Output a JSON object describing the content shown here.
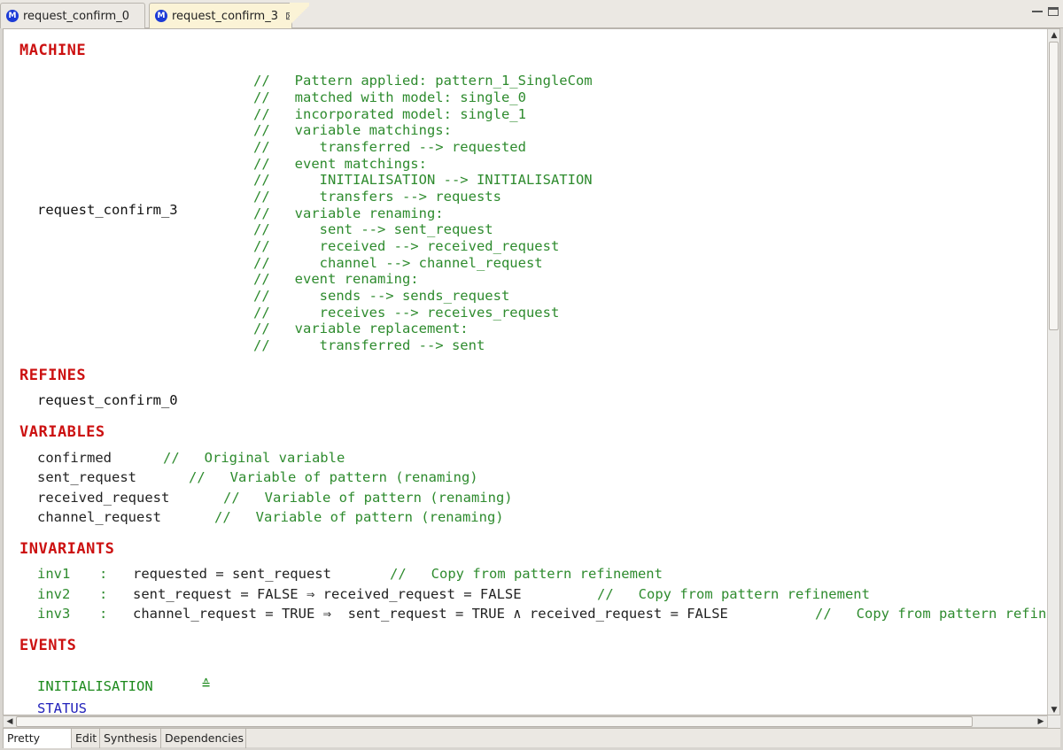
{
  "tabs": [
    {
      "label": "request_confirm_0",
      "active": false
    },
    {
      "label": "request_confirm_3",
      "active": true
    }
  ],
  "tab_icon_letter": "M",
  "machine": {
    "keyword": "MACHINE",
    "name": "request_confirm_3",
    "comments": [
      "//   Pattern applied: pattern_1_SingleCom",
      "//   matched with model: single_0",
      "//   incorporated model: single_1",
      "//   variable matchings:",
      "//      transferred --> requested",
      "//   event matchings:",
      "//      INITIALISATION --> INITIALISATION",
      "//      transfers --> requests",
      "//   variable renaming:",
      "//      sent --> sent_request",
      "//      received --> received_request",
      "//      channel --> channel_request",
      "//   event renaming:",
      "//      sends --> sends_request",
      "//      receives --> receives_request",
      "//   variable replacement:",
      "//      transferred --> sent"
    ]
  },
  "refines": {
    "keyword": "REFINES",
    "name": "request_confirm_0"
  },
  "variables": {
    "keyword": "VARIABLES",
    "items": [
      {
        "name": "confirmed",
        "comment": "//   Original variable"
      },
      {
        "name": "sent_request",
        "comment": "//   Variable of pattern (renaming)"
      },
      {
        "name": "received_request",
        "comment": "//   Variable of pattern (renaming)"
      },
      {
        "name": "channel_request",
        "comment": "//   Variable of pattern (renaming)"
      }
    ]
  },
  "invariants": {
    "keyword": "INVARIANTS",
    "items": [
      {
        "label": "inv1",
        "sep": ":",
        "expr": "requested = sent_request",
        "comment": "//   Copy from pattern refinement"
      },
      {
        "label": "inv2",
        "sep": ":",
        "expr": "sent_request = FALSE ⇒ received_request = FALSE",
        "comment": "//   Copy from pattern refinement"
      },
      {
        "label": "inv3",
        "sep": ":",
        "expr": "channel_request = TRUE ⇒  sent_request = TRUE ∧ received_request = FALSE",
        "comment": "//   Copy from pattern refinement"
      }
    ]
  },
  "events": {
    "keyword": "EVENTS",
    "initialisation": "INITIALISATION",
    "def_symbol": "≙",
    "status": "STATUS"
  },
  "bottom_tabs": [
    "Pretty Print",
    "Edit",
    "Synthesis",
    "Dependencies"
  ]
}
